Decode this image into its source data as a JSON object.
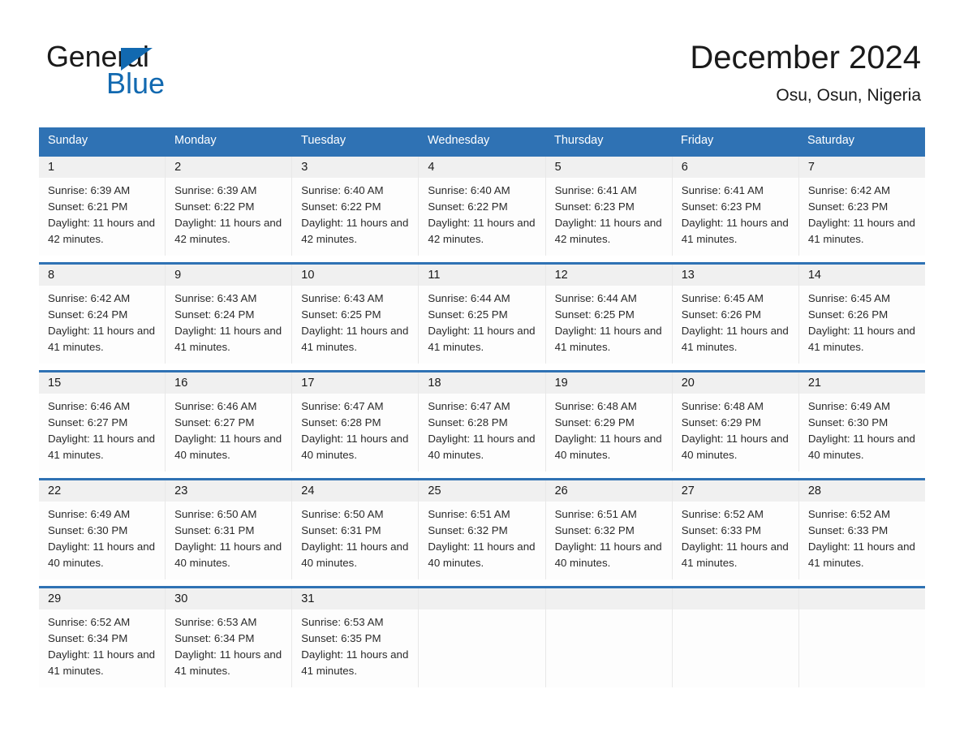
{
  "brand": {
    "name_part1": "General",
    "name_part2": "Blue",
    "accent_color": "#1269b0",
    "triangle_icon": "triangle-icon"
  },
  "header": {
    "title": "December 2024",
    "subtitle": "Osu, Osun, Nigeria"
  },
  "theme": {
    "header_blue": "#2f72b4",
    "daynum_gray": "#f0f0f0",
    "text_dark": "#1a1a1a"
  },
  "calendar": {
    "weekdays": [
      "Sunday",
      "Monday",
      "Tuesday",
      "Wednesday",
      "Thursday",
      "Friday",
      "Saturday"
    ],
    "weeks": [
      [
        {
          "day": "1",
          "sunrise": "Sunrise: 6:39 AM",
          "sunset": "Sunset: 6:21 PM",
          "daylight": "Daylight: 11 hours and 42 minutes."
        },
        {
          "day": "2",
          "sunrise": "Sunrise: 6:39 AM",
          "sunset": "Sunset: 6:22 PM",
          "daylight": "Daylight: 11 hours and 42 minutes."
        },
        {
          "day": "3",
          "sunrise": "Sunrise: 6:40 AM",
          "sunset": "Sunset: 6:22 PM",
          "daylight": "Daylight: 11 hours and 42 minutes."
        },
        {
          "day": "4",
          "sunrise": "Sunrise: 6:40 AM",
          "sunset": "Sunset: 6:22 PM",
          "daylight": "Daylight: 11 hours and 42 minutes."
        },
        {
          "day": "5",
          "sunrise": "Sunrise: 6:41 AM",
          "sunset": "Sunset: 6:23 PM",
          "daylight": "Daylight: 11 hours and 42 minutes."
        },
        {
          "day": "6",
          "sunrise": "Sunrise: 6:41 AM",
          "sunset": "Sunset: 6:23 PM",
          "daylight": "Daylight: 11 hours and 41 minutes."
        },
        {
          "day": "7",
          "sunrise": "Sunrise: 6:42 AM",
          "sunset": "Sunset: 6:23 PM",
          "daylight": "Daylight: 11 hours and 41 minutes."
        }
      ],
      [
        {
          "day": "8",
          "sunrise": "Sunrise: 6:42 AM",
          "sunset": "Sunset: 6:24 PM",
          "daylight": "Daylight: 11 hours and 41 minutes."
        },
        {
          "day": "9",
          "sunrise": "Sunrise: 6:43 AM",
          "sunset": "Sunset: 6:24 PM",
          "daylight": "Daylight: 11 hours and 41 minutes."
        },
        {
          "day": "10",
          "sunrise": "Sunrise: 6:43 AM",
          "sunset": "Sunset: 6:25 PM",
          "daylight": "Daylight: 11 hours and 41 minutes."
        },
        {
          "day": "11",
          "sunrise": "Sunrise: 6:44 AM",
          "sunset": "Sunset: 6:25 PM",
          "daylight": "Daylight: 11 hours and 41 minutes."
        },
        {
          "day": "12",
          "sunrise": "Sunrise: 6:44 AM",
          "sunset": "Sunset: 6:25 PM",
          "daylight": "Daylight: 11 hours and 41 minutes."
        },
        {
          "day": "13",
          "sunrise": "Sunrise: 6:45 AM",
          "sunset": "Sunset: 6:26 PM",
          "daylight": "Daylight: 11 hours and 41 minutes."
        },
        {
          "day": "14",
          "sunrise": "Sunrise: 6:45 AM",
          "sunset": "Sunset: 6:26 PM",
          "daylight": "Daylight: 11 hours and 41 minutes."
        }
      ],
      [
        {
          "day": "15",
          "sunrise": "Sunrise: 6:46 AM",
          "sunset": "Sunset: 6:27 PM",
          "daylight": "Daylight: 11 hours and 41 minutes."
        },
        {
          "day": "16",
          "sunrise": "Sunrise: 6:46 AM",
          "sunset": "Sunset: 6:27 PM",
          "daylight": "Daylight: 11 hours and 40 minutes."
        },
        {
          "day": "17",
          "sunrise": "Sunrise: 6:47 AM",
          "sunset": "Sunset: 6:28 PM",
          "daylight": "Daylight: 11 hours and 40 minutes."
        },
        {
          "day": "18",
          "sunrise": "Sunrise: 6:47 AM",
          "sunset": "Sunset: 6:28 PM",
          "daylight": "Daylight: 11 hours and 40 minutes."
        },
        {
          "day": "19",
          "sunrise": "Sunrise: 6:48 AM",
          "sunset": "Sunset: 6:29 PM",
          "daylight": "Daylight: 11 hours and 40 minutes."
        },
        {
          "day": "20",
          "sunrise": "Sunrise: 6:48 AM",
          "sunset": "Sunset: 6:29 PM",
          "daylight": "Daylight: 11 hours and 40 minutes."
        },
        {
          "day": "21",
          "sunrise": "Sunrise: 6:49 AM",
          "sunset": "Sunset: 6:30 PM",
          "daylight": "Daylight: 11 hours and 40 minutes."
        }
      ],
      [
        {
          "day": "22",
          "sunrise": "Sunrise: 6:49 AM",
          "sunset": "Sunset: 6:30 PM",
          "daylight": "Daylight: 11 hours and 40 minutes."
        },
        {
          "day": "23",
          "sunrise": "Sunrise: 6:50 AM",
          "sunset": "Sunset: 6:31 PM",
          "daylight": "Daylight: 11 hours and 40 minutes."
        },
        {
          "day": "24",
          "sunrise": "Sunrise: 6:50 AM",
          "sunset": "Sunset: 6:31 PM",
          "daylight": "Daylight: 11 hours and 40 minutes."
        },
        {
          "day": "25",
          "sunrise": "Sunrise: 6:51 AM",
          "sunset": "Sunset: 6:32 PM",
          "daylight": "Daylight: 11 hours and 40 minutes."
        },
        {
          "day": "26",
          "sunrise": "Sunrise: 6:51 AM",
          "sunset": "Sunset: 6:32 PM",
          "daylight": "Daylight: 11 hours and 40 minutes."
        },
        {
          "day": "27",
          "sunrise": "Sunrise: 6:52 AM",
          "sunset": "Sunset: 6:33 PM",
          "daylight": "Daylight: 11 hours and 41 minutes."
        },
        {
          "day": "28",
          "sunrise": "Sunrise: 6:52 AM",
          "sunset": "Sunset: 6:33 PM",
          "daylight": "Daylight: 11 hours and 41 minutes."
        }
      ],
      [
        {
          "day": "29",
          "sunrise": "Sunrise: 6:52 AM",
          "sunset": "Sunset: 6:34 PM",
          "daylight": "Daylight: 11 hours and 41 minutes."
        },
        {
          "day": "30",
          "sunrise": "Sunrise: 6:53 AM",
          "sunset": "Sunset: 6:34 PM",
          "daylight": "Daylight: 11 hours and 41 minutes."
        },
        {
          "day": "31",
          "sunrise": "Sunrise: 6:53 AM",
          "sunset": "Sunset: 6:35 PM",
          "daylight": "Daylight: 11 hours and 41 minutes."
        },
        {
          "day": "",
          "sunrise": "",
          "sunset": "",
          "daylight": ""
        },
        {
          "day": "",
          "sunrise": "",
          "sunset": "",
          "daylight": ""
        },
        {
          "day": "",
          "sunrise": "",
          "sunset": "",
          "daylight": ""
        },
        {
          "day": "",
          "sunrise": "",
          "sunset": "",
          "daylight": ""
        }
      ]
    ]
  }
}
